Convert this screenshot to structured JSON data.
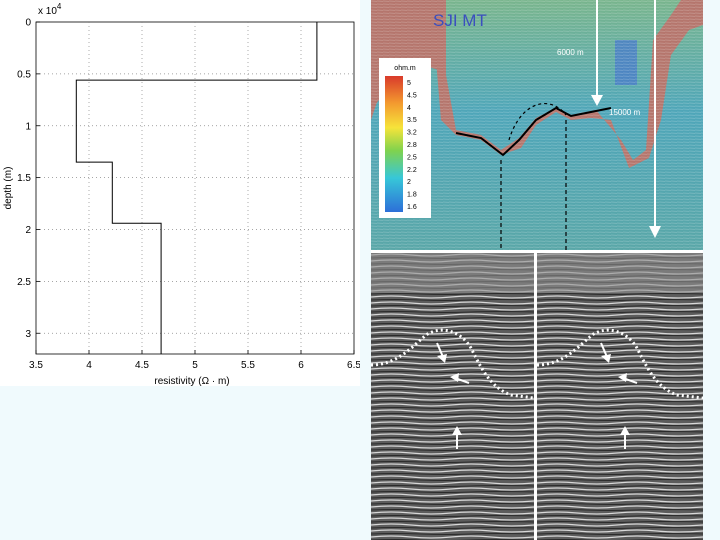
{
  "chart_data": {
    "type": "line",
    "title": "",
    "xlabel": "resistivity (Ω · m)",
    "ylabel": "depth (m)",
    "y_multiplier_label": "x 10",
    "y_multiplier_exp": "4",
    "xlim": [
      3.5,
      6.5
    ],
    "ylim": [
      0,
      3.2
    ],
    "y_inverted": true,
    "grid": true,
    "x_ticks": [
      "3.5",
      "4",
      "4.5",
      "5",
      "5.5",
      "6",
      "6.5"
    ],
    "x_tick_values": [
      3.5,
      4,
      4.5,
      5,
      5.5,
      6,
      6.5
    ],
    "y_ticks": [
      "0",
      "0.5",
      "1",
      "1.5",
      "2",
      "2.5",
      "3"
    ],
    "y_tick_values": [
      0,
      0.5,
      1,
      1.5,
      2,
      2.5,
      3
    ],
    "series": [
      {
        "points": [
          [
            6.15,
            0
          ],
          [
            6.15,
            0.56
          ],
          [
            3.88,
            0.56
          ],
          [
            3.88,
            1.35
          ],
          [
            4.22,
            1.35
          ],
          [
            4.22,
            1.94
          ],
          [
            4.68,
            1.94
          ],
          [
            4.68,
            3.2
          ]
        ]
      }
    ]
  },
  "mt_section": {
    "title": "SJI MT",
    "label_6000": "6000 m",
    "label_15000": "15000 m",
    "colorbar_unit": "ohm.m",
    "colorbar_ticks": [
      "5",
      "4.5",
      "4",
      "3.5",
      "3.2",
      "2.8",
      "2.5",
      "2.2",
      "2",
      "1.8",
      "1.6"
    ],
    "colors": [
      "#d93a2b",
      "#f39a2f",
      "#f6e43a",
      "#7fd24e",
      "#37c7d8",
      "#2d6fd8"
    ]
  },
  "seismic": {
    "panels": [
      "left",
      "right"
    ]
  }
}
